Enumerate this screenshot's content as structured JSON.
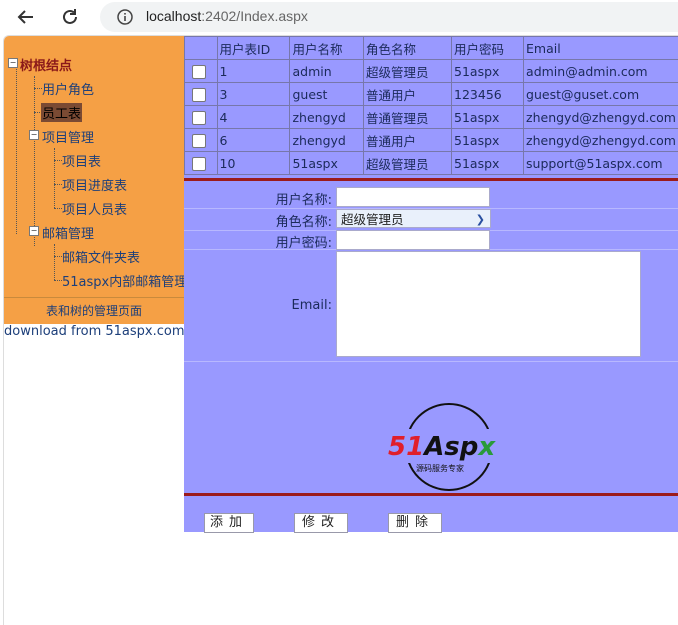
{
  "browser": {
    "url_host": "localhost",
    "url_rest": ":2402/Index.aspx"
  },
  "tree": {
    "root": "树根结点",
    "items": [
      {
        "label": "用户角色"
      },
      {
        "label": "员工表"
      },
      {
        "label": "项目管理"
      },
      {
        "label": "项目表"
      },
      {
        "label": "项目进度表"
      },
      {
        "label": "项目人员表"
      },
      {
        "label": "邮箱管理"
      },
      {
        "label": "邮箱文件夹表"
      },
      {
        "label": "51aspx内部邮箱管理"
      }
    ],
    "footer": "表和树的管理页面"
  },
  "download_link": "download from 51aspx.com",
  "table": {
    "headers": [
      "用户表ID",
      "用户名称",
      "角色名称",
      "用户密码",
      "Email"
    ],
    "rows": [
      [
        "1",
        "admin",
        "超级管理员",
        "51aspx",
        "admin@admin.com"
      ],
      [
        "3",
        "guest",
        "普通用户",
        "123456",
        "guest@guset.com"
      ],
      [
        "4",
        "zhengyd",
        "普通管理员",
        "51aspx",
        "zhengyd@zhengyd.com"
      ],
      [
        "6",
        "zhengyd",
        "普通用户",
        "51aspx",
        "zhengyd@zhengyd.com"
      ],
      [
        "10",
        "51aspx",
        "超级管理员",
        "51aspx",
        "support@51aspx.com"
      ]
    ]
  },
  "form": {
    "username_label": "用户名称:",
    "role_label": "角色名称:",
    "role_selected": "超级管理员",
    "password_label": "用户密码:",
    "email_label": "Email:"
  },
  "logo": {
    "brand": "51Aspx",
    "tagline": "源码服务专家"
  },
  "buttons": {
    "add": "添加",
    "edit": "修改",
    "delete": "删除"
  },
  "colors": {
    "tree_bg": "#f5a045",
    "panel_bg": "#9999ff",
    "divider": "#9b1b1b"
  }
}
